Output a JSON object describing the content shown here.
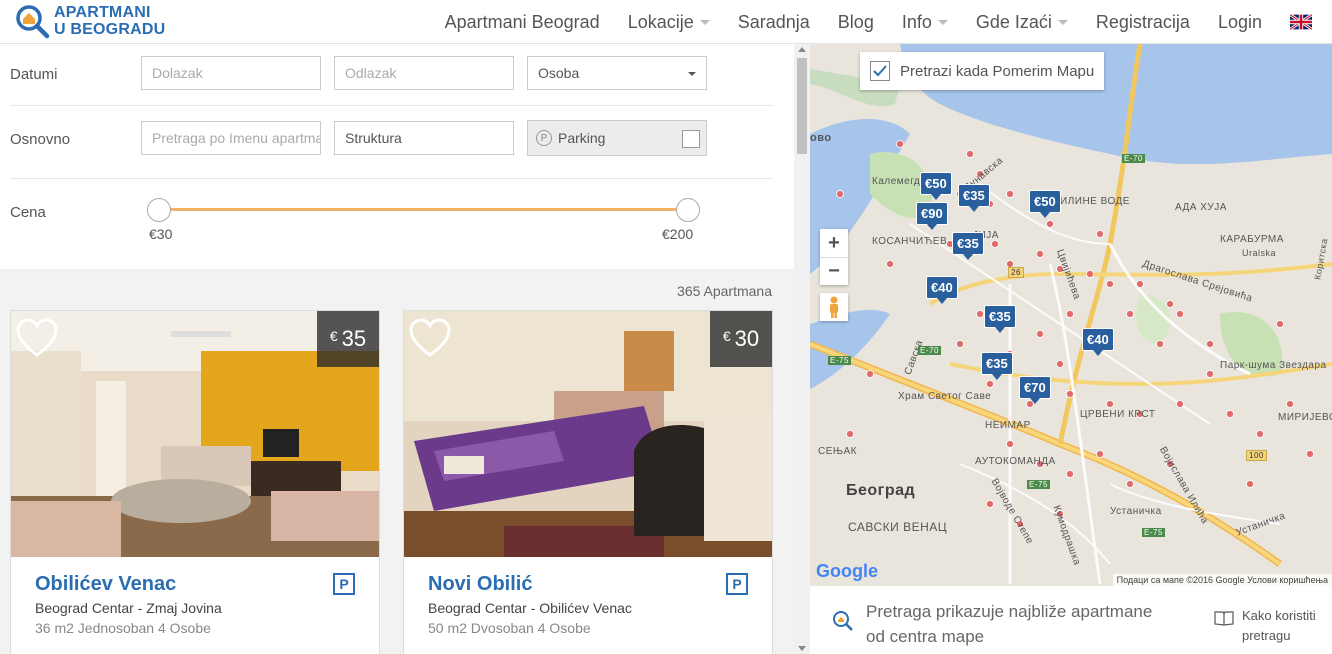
{
  "logo": {
    "line1": "APARTMANI",
    "line2": "U BEOGRADU"
  },
  "nav": [
    {
      "label": "Apartmani Beograd",
      "dropdown": false
    },
    {
      "label": "Lokacije",
      "dropdown": true
    },
    {
      "label": "Saradnja",
      "dropdown": false
    },
    {
      "label": "Blog",
      "dropdown": false
    },
    {
      "label": "Info",
      "dropdown": true
    },
    {
      "label": "Gde Izaći",
      "dropdown": true
    },
    {
      "label": "Registracija",
      "dropdown": false
    },
    {
      "label": "Login",
      "dropdown": false
    }
  ],
  "filters": {
    "dates_label": "Datumi",
    "arrival_placeholder": "Dolazak",
    "departure_placeholder": "Odlazak",
    "guests_value": "Osoba",
    "basic_label": "Osnovno",
    "name_search_placeholder": "Pretraga po Imenu apartmana",
    "structure_value": "Struktura",
    "parking_label": "Parking",
    "price_label": "Cena",
    "price_min": "€30",
    "price_max": "€200"
  },
  "results": {
    "count": "365 Apartmana",
    "cards": [
      {
        "price_currency": "€",
        "price": "35",
        "title": "Obilićev Venac",
        "location": "Beograd Centar - Zmaj Jovina",
        "meta": "36 m2 Jednosoban 4 Osobe",
        "parking_badge": "P"
      },
      {
        "price_currency": "€",
        "price": "30",
        "title": "Novi Obilić",
        "location": "Beograd Centar - Obilićev Venac",
        "meta": "50 m2 Dvosoban 4 Osobe",
        "parking_badge": "P"
      }
    ]
  },
  "map": {
    "move_search_label": "Pretrazi kada Pomerim Mapu",
    "move_search_checked": true,
    "zoom_in": "+",
    "zoom_out": "−",
    "markers": [
      "€50",
      "€35",
      "€90",
      "€50",
      "€35",
      "€40",
      "€35",
      "€40",
      "€35",
      "€70"
    ],
    "labels": {
      "kalemegdan": "Калемегд",
      "kosancicev": "КОСАНЧИЋЕВ",
      "dunavska": "Дунавска",
      "linije_vode": "ИЛИНЕ ВОДЕ",
      "ada_huja": "АДА ХУЈА",
      "karaburma": "КАРАБУРМА",
      "uralska": "Uralska",
      "koritska": "Коритска",
      "dragoslava": "Драгослава Срејовића",
      "park_suma": "Парк-шума Звездара",
      "hram": "Храм Светог Саве",
      "crveni_krst": "ЦРВЕНИ КРСТ",
      "mirijevo": "МИРИЈЕВО",
      "senjak": "СЕЊАК",
      "neimar": "НЕИМАР",
      "autokomanda": "АУТОКОМАНДА",
      "beograd": "Београд",
      "savski_venac": "САВСКИ ВЕНАЦ",
      "ustanicka": "Устаничка",
      "ovo": "ово",
      "cvijiceva": "Цвијићева",
      "savska": "Савска",
      "bulevar": "Булевар Ослобођења",
      "kumodraska": "Кумодрашка",
      "ijuja": "ЈИЈА",
      "voj_stepe": "Војводе Степе",
      "vojislava_ilica": "Војислава Илића",
      "e70": "E-70",
      "e75": "E-75",
      "r100": "100",
      "r26": "26"
    },
    "google": "Google",
    "footer": "Подаци са мапе ©2016 Google   Услови коришћења"
  },
  "map_bottom": {
    "text": "Pretraga prikazuje najbliže apartmane od centra mape",
    "help_line1": "Kako koristiti",
    "help_line2": "pretragu"
  },
  "colors": {
    "brand_blue": "#2a6db3",
    "slider_orange": "#f0b265",
    "marker_blue": "#2a5f9e"
  }
}
